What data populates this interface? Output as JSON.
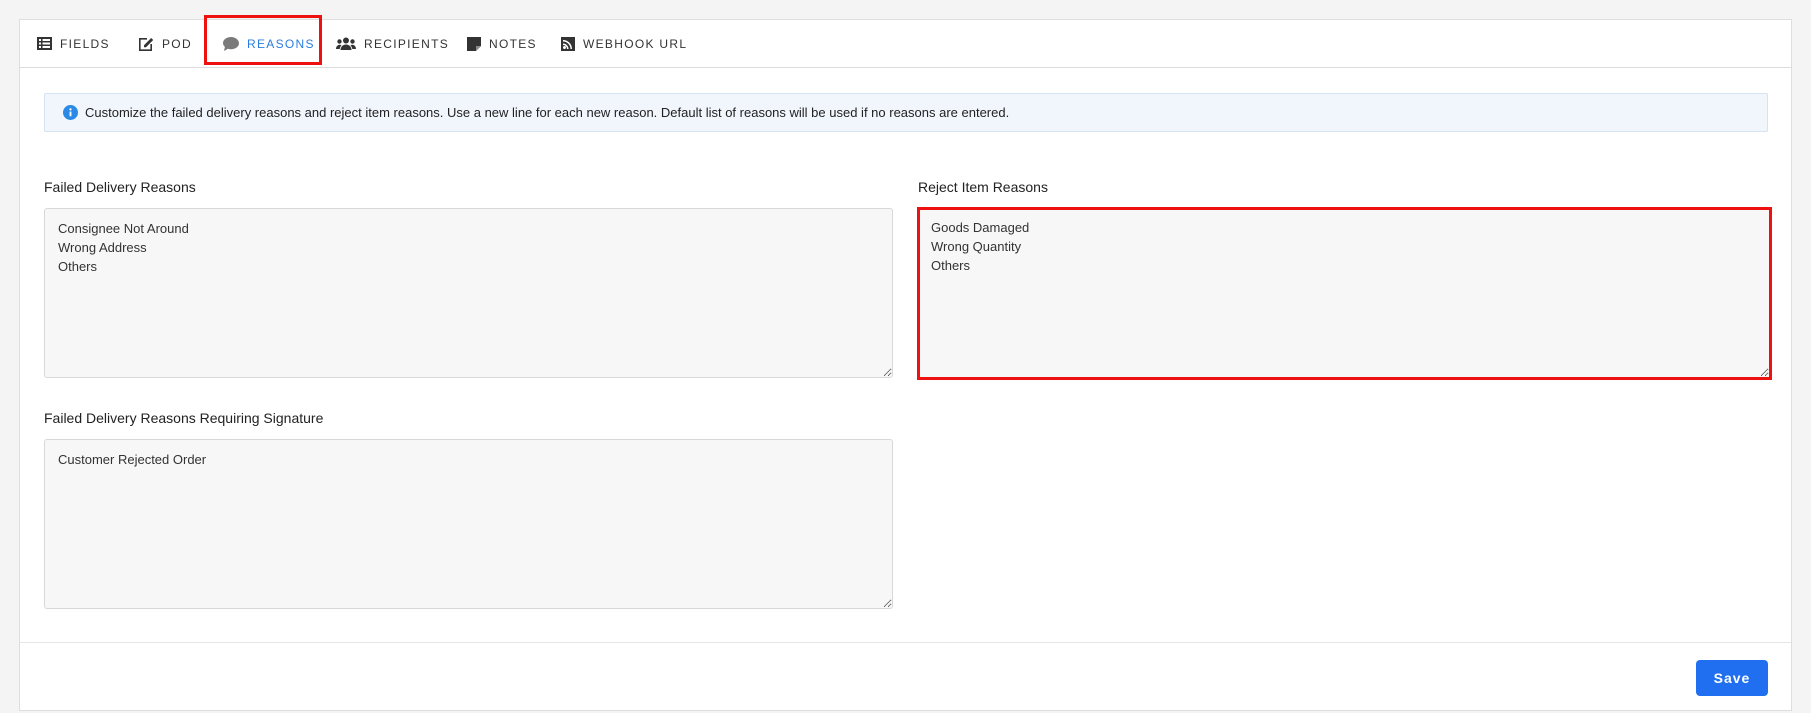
{
  "tabs": [
    {
      "label": "FIELDS",
      "icon": "list-icon"
    },
    {
      "label": "POD",
      "icon": "edit-icon"
    },
    {
      "label": "REASONS",
      "icon": "comment-icon",
      "active": true
    },
    {
      "label": "RECIPIENTS",
      "icon": "users-icon"
    },
    {
      "label": "NOTES",
      "icon": "sticky-note-icon"
    },
    {
      "label": "WEBHOOK URL",
      "icon": "rss-icon"
    }
  ],
  "info": {
    "text": "Customize the failed delivery reasons and reject item reasons. Use a new line for each new reason. Default list of reasons will be used if no reasons are entered."
  },
  "failed_delivery": {
    "label": "Failed Delivery Reasons",
    "value": "Consignee Not Around\nWrong Address\nOthers"
  },
  "reject_item": {
    "label": "Reject Item Reasons",
    "value": "Goods Damaged\nWrong Quantity\nOthers"
  },
  "failed_signature": {
    "label": "Failed Delivery Reasons Requiring Signature",
    "value": "Customer Rejected Order"
  },
  "footer": {
    "save_label": "Save"
  },
  "colors": {
    "accent": "#2b7de0",
    "button": "#1f6ff0",
    "highlight": "#ee1111",
    "info_bg": "#f1f6fd"
  }
}
